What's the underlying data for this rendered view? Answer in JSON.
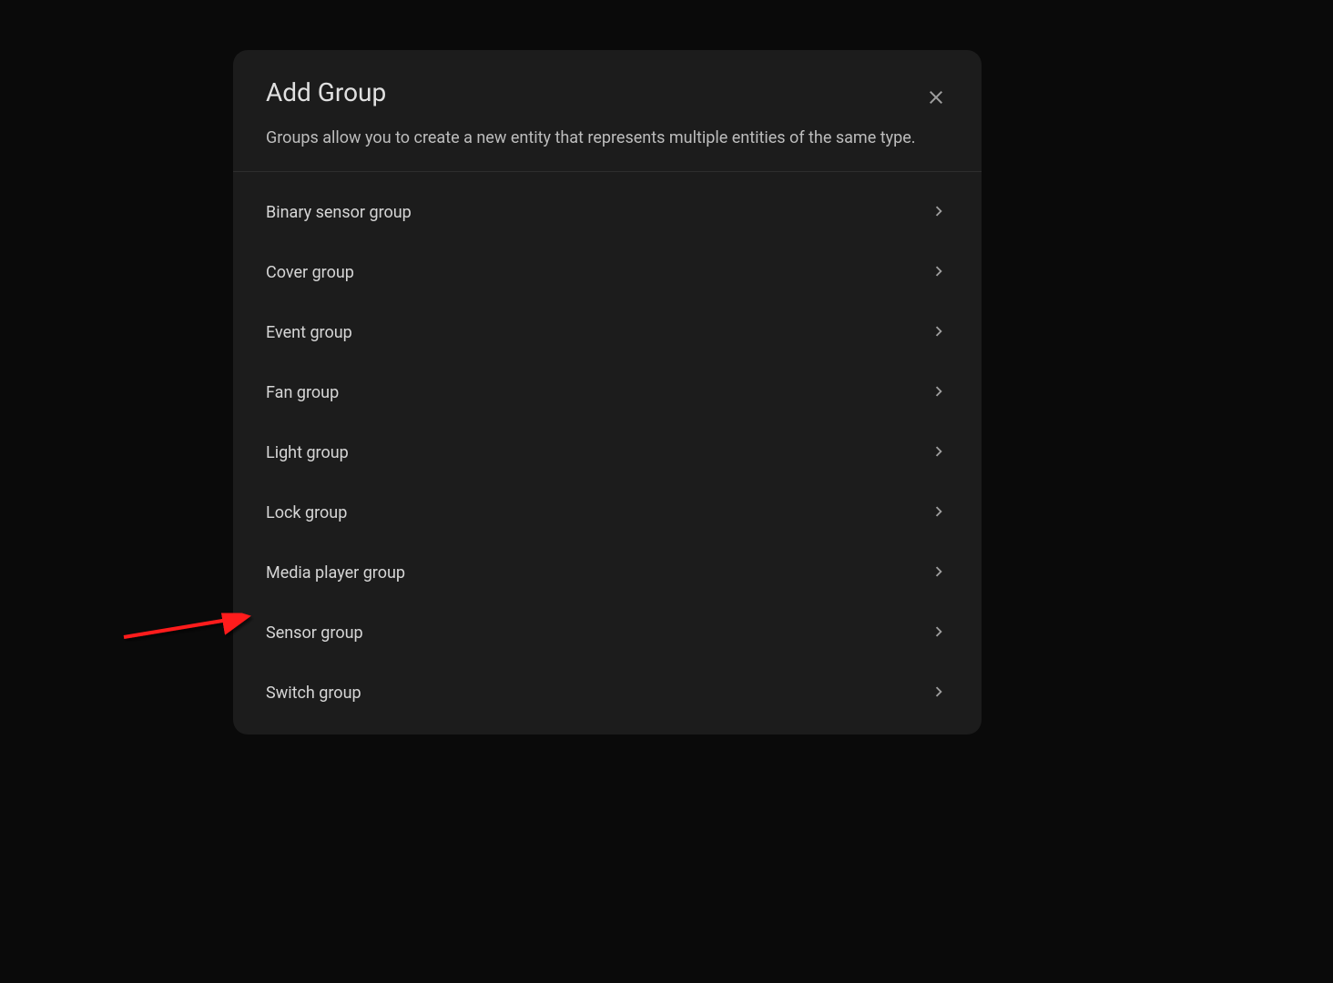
{
  "dialog": {
    "title": "Add Group",
    "description": "Groups allow you to create a new entity that represents multiple entities of the same type.",
    "items": [
      {
        "label": "Binary sensor group"
      },
      {
        "label": "Cover group"
      },
      {
        "label": "Event group"
      },
      {
        "label": "Fan group"
      },
      {
        "label": "Light group"
      },
      {
        "label": "Lock group"
      },
      {
        "label": "Media player group"
      },
      {
        "label": "Sensor group"
      },
      {
        "label": "Switch group"
      }
    ]
  },
  "annotation": {
    "target_index": 6,
    "color": "#ff1a1a"
  }
}
